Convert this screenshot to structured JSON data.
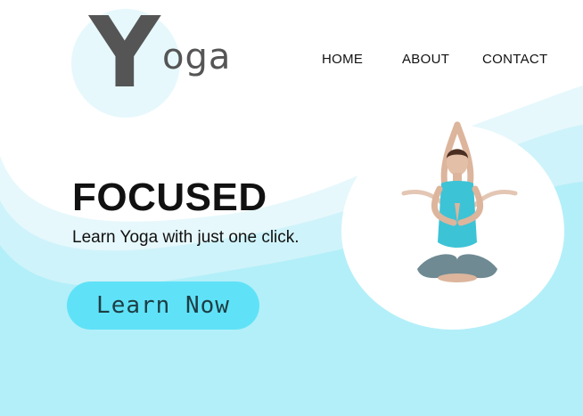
{
  "brand": {
    "logo_initial": "Y",
    "logo_rest": "oga"
  },
  "nav": {
    "home": "HOME",
    "about": "ABOUT",
    "contact": "CONTACT"
  },
  "hero": {
    "title": "FOCUSED",
    "subtitle": "Learn Yoga with just one click.",
    "cta_label": "Learn Now"
  },
  "colors": {
    "background": "#ffffff",
    "wave_light": "#e6f8fc",
    "wave_mid": "#cff3fa",
    "wave_main": "#b3eff9",
    "button": "#5fe2f7",
    "text": "#111111",
    "logo": "#555555",
    "top_teal": "#3cc3d6"
  }
}
